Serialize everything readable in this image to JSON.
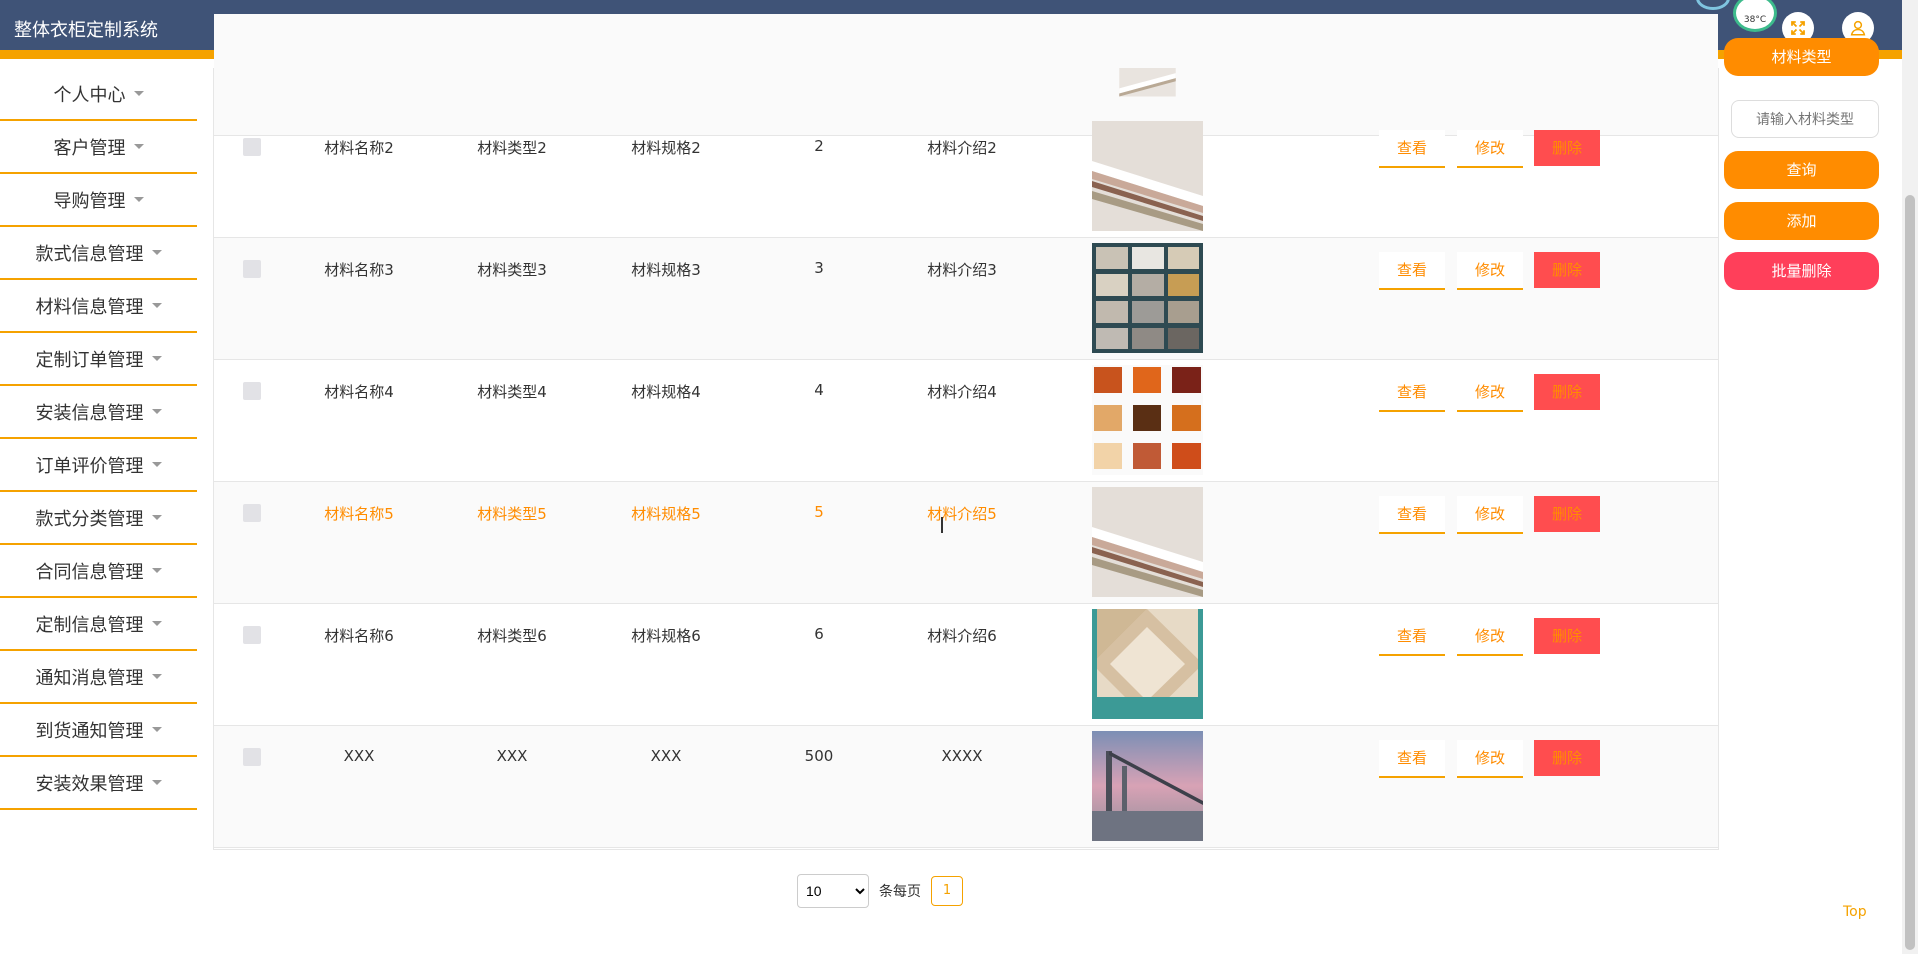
{
  "app": {
    "title": "整体衣柜定制系统"
  },
  "weather": {
    "temp": "38°C"
  },
  "sidebar": {
    "items": [
      {
        "label": "个人中心"
      },
      {
        "label": "客户管理"
      },
      {
        "label": "导购管理"
      },
      {
        "label": "款式信息管理"
      },
      {
        "label": "材料信息管理"
      },
      {
        "label": "定制订单管理"
      },
      {
        "label": "安装信息管理"
      },
      {
        "label": "订单评价管理"
      },
      {
        "label": "款式分类管理"
      },
      {
        "label": "合同信息管理"
      },
      {
        "label": "定制信息管理"
      },
      {
        "label": "通知消息管理"
      },
      {
        "label": "到货通知管理"
      },
      {
        "label": "安装效果管理"
      }
    ]
  },
  "table": {
    "actions": {
      "view": "查看",
      "edit": "修改",
      "delete": "删除"
    },
    "rows": [
      {
        "name": "材料名称2",
        "type": "材料类型2",
        "spec": "材料规格2",
        "qty": "2",
        "intro": "材料介绍2",
        "img": "wood-boards"
      },
      {
        "name": "材料名称3",
        "type": "材料类型3",
        "spec": "材料规格3",
        "qty": "3",
        "intro": "材料介绍3",
        "img": "stone-tiles"
      },
      {
        "name": "材料名称4",
        "type": "材料类型4",
        "spec": "材料规格4",
        "qty": "4",
        "intro": "材料介绍4",
        "img": "wood-swatches"
      },
      {
        "name": "材料名称5",
        "type": "材料类型5",
        "spec": "材料规格5",
        "qty": "5",
        "intro": "材料介绍5",
        "img": "wood-boards"
      },
      {
        "name": "材料名称6",
        "type": "材料类型6",
        "spec": "材料规格6",
        "qty": "6",
        "intro": "材料介绍6",
        "img": "diamond-tile"
      },
      {
        "name": "XXX",
        "type": "XXX",
        "spec": "XXX",
        "qty": "500",
        "intro": "XXXX",
        "img": "city-bridge"
      }
    ]
  },
  "right_panel": {
    "type_label": "材料类型",
    "type_placeholder": "请输入材料类型",
    "search": "查询",
    "add": "添加",
    "batch_delete": "批量删除"
  },
  "pagination": {
    "page_size": "10",
    "page_size_options": [
      "10"
    ],
    "per_page_label": "条每页",
    "current_page": "1"
  },
  "top_link": "Top",
  "colors": {
    "header": "#3f5377",
    "accent": "#f5a200",
    "orange": "#ff8c00",
    "danger": "#ff4d4f"
  }
}
